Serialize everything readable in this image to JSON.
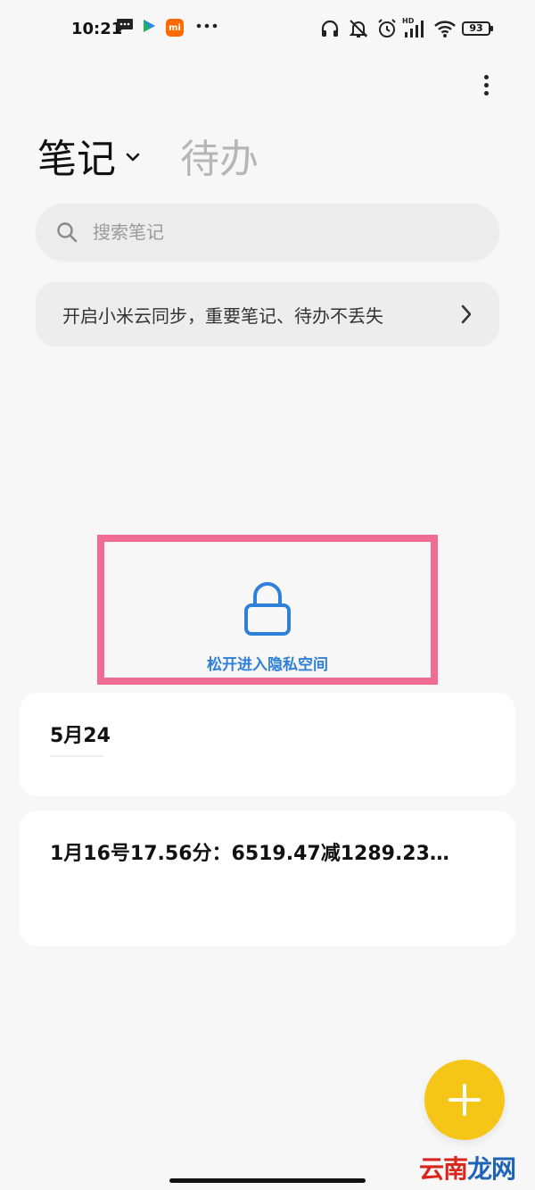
{
  "status_bar": {
    "time": "10:21",
    "battery": "93",
    "network_label": "HD"
  },
  "header": {
    "tab_notes": "笔记",
    "tab_todo": "待办"
  },
  "search": {
    "placeholder": "搜索笔记"
  },
  "sync_banner": {
    "label": "开启小米云同步，重要笔记、待办不丢失"
  },
  "privacy": {
    "label": "松开进入隐私空间"
  },
  "notes": [
    {
      "title": "5月24"
    },
    {
      "title": "1月16号17.56分：6519.47减1289.23…"
    }
  ],
  "fab": {
    "icon": "plus-icon"
  },
  "watermark": {
    "part_a": "云南",
    "part_b": "龙网"
  },
  "colors": {
    "accent": "#f5c518",
    "privacy_blue": "#2f80d8",
    "highlight_pink": "#f06b93",
    "background": "#f7f7f7"
  }
}
